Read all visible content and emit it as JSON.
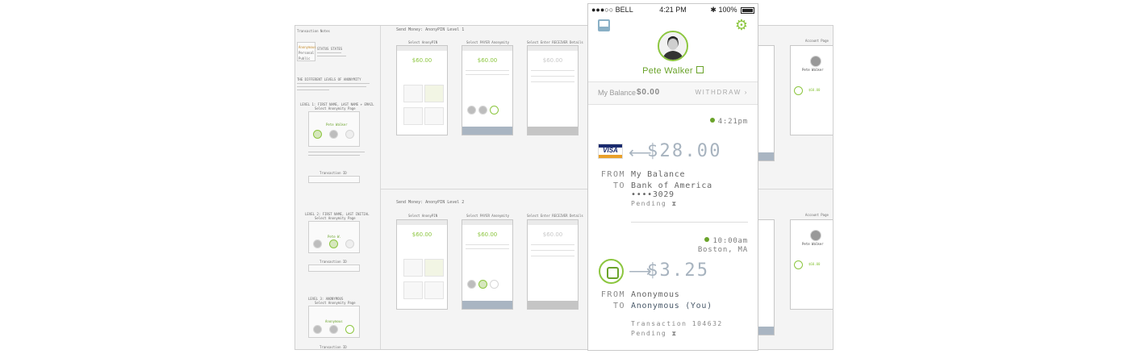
{
  "wireframe": {
    "left_title": "Transaction Notes",
    "left_labels": [
      "Anonymous",
      "Personal",
      "Public"
    ],
    "status_title": "STATUS STATES",
    "levels_title": "THE DIFFERENT LEVELS OF ANONYMITY",
    "level1": "LEVEL 1: FIRST NAME, LAST NAME + EMAIL",
    "level1_sub": "Select Anonymity Page",
    "level1_name": "Pete Walker",
    "level2": "LEVEL 2: FIRST NAME, LAST INITIAL",
    "level2_sub": "Select Anonymity Page",
    "level2_name": "Pete W.",
    "level3": "LEVEL 3: ANONYMOUS",
    "level3_sub": "Select Anonymity Page",
    "level3_name": "Anonymous",
    "transaction_id_label": "Transaction ID",
    "section1_title": "Send Money: AnonyPIN Level 1",
    "section2_title": "Send Money: AnonyPIN  Level 2",
    "screen_labels": [
      "Select AnonyPIN",
      "Select PAYER Anonymity",
      "Select Enter RECEIVER Details"
    ],
    "screen_amount": "$60.00",
    "account_label": "Account Page",
    "account_name": "Pete Walker",
    "account_amount": "$60.00"
  },
  "phone": {
    "status": {
      "carrier": "●●●○○ BELL",
      "time": "4:21 PM",
      "battery": "100%"
    },
    "user_name": "Pete Walker",
    "balance": {
      "label": "My Balance",
      "amount": "$0.00",
      "withdraw": "WITHDRAW"
    },
    "txn1": {
      "time": "4:21pm",
      "amount": "$28.00",
      "from_label": "FROM",
      "from_value": "My Balance",
      "to_label": "TO",
      "to_value": "Bank of America ••••3029",
      "status": "Pending ⧗"
    },
    "txn2": {
      "time": "10:00am",
      "location": "Boston, MA",
      "amount": "$3.25",
      "from_label": "FROM",
      "from_value": "Anonymous",
      "to_label": "TO",
      "to_value": "Anonymous (You)",
      "transaction": "Transaction 104632",
      "status": "Pending ⧗"
    },
    "colors": {
      "accent": "#8cc63f",
      "amount": "#a7b3bf",
      "icon_blue": "#8ab0c6"
    }
  }
}
